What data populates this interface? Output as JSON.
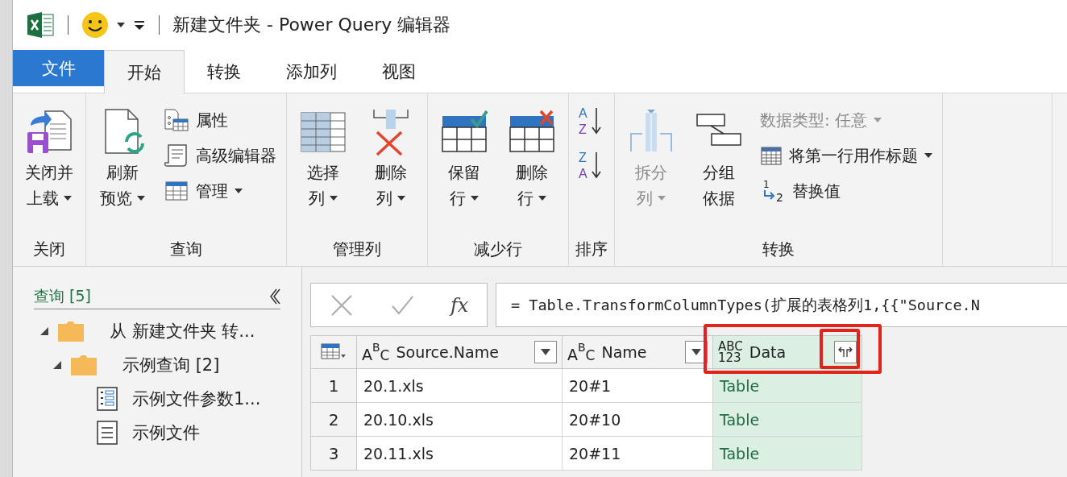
{
  "window": {
    "title": "新建文件夹 - Power Query 编辑器"
  },
  "tabs": [
    {
      "label": "文件",
      "kind": "file",
      "selected": false
    },
    {
      "label": "开始",
      "kind": "tab",
      "selected": true
    },
    {
      "label": "转换",
      "kind": "tab",
      "selected": false
    },
    {
      "label": "添加列",
      "kind": "tab",
      "selected": false
    },
    {
      "label": "视图",
      "kind": "tab",
      "selected": false
    }
  ],
  "ribbon": [
    {
      "label": "关闭",
      "items": [
        {
          "kind": "big",
          "lines": [
            "关闭并",
            "上载"
          ],
          "menu": true,
          "disabled": false
        }
      ]
    },
    {
      "label": "查询",
      "items": [
        {
          "kind": "big",
          "lines": [
            "刷新",
            "预览"
          ],
          "menu": true,
          "disabled": false
        },
        {
          "kind": "stack",
          "items": [
            {
              "label": "属性",
              "menu": false,
              "disabled": false
            },
            {
              "label": "高级编辑器",
              "menu": false,
              "disabled": false
            },
            {
              "label": "管理",
              "menu": true,
              "disabled": false
            }
          ]
        }
      ]
    },
    {
      "label": "管理列",
      "items": [
        {
          "kind": "big",
          "lines": [
            "选择",
            "列"
          ],
          "menu": true,
          "disabled": false
        },
        {
          "kind": "big",
          "lines": [
            "删除",
            "列"
          ],
          "menu": true,
          "disabled": false
        }
      ]
    },
    {
      "label": "减少行",
      "items": [
        {
          "kind": "big",
          "lines": [
            "保留",
            "行"
          ],
          "menu": true,
          "disabled": false
        },
        {
          "kind": "big",
          "lines": [
            "删除",
            "行"
          ],
          "menu": true,
          "disabled": false
        }
      ]
    },
    {
      "label": "排序",
      "items": [
        {
          "kind": "sort",
          "buttons": [
            {
              "from": "A",
              "to": "Z"
            },
            {
              "from": "Z",
              "to": "A"
            }
          ]
        }
      ]
    },
    {
      "label": "转换",
      "items": [
        {
          "kind": "big",
          "lines": [
            "拆分",
            "列"
          ],
          "menu": true,
          "disabled": true
        },
        {
          "kind": "big",
          "lines": [
            "分组",
            "依据"
          ],
          "menu": false,
          "disabled": false
        },
        {
          "kind": "stack",
          "items": [
            {
              "label": "数据类型: 任意",
              "menu": true,
              "disabled": true
            },
            {
              "label": "将第一行用作标题",
              "menu": true,
              "disabled": false
            },
            {
              "label": "替换值",
              "menu": false,
              "disabled": false,
              "glyphs": [
                "1",
                "2"
              ]
            }
          ]
        }
      ]
    }
  ],
  "queries": {
    "title": "查询 [5]",
    "tree": [
      {
        "label": "从 新建文件夹 转...",
        "kind": "folder",
        "expanded": true,
        "children": [
          {
            "label": "示例查询 [2]",
            "kind": "folder",
            "expanded": true,
            "children": [
              {
                "label": "示例文件参数1...",
                "kind": "parameter"
              },
              {
                "label": "示例文件",
                "kind": "table"
              }
            ]
          }
        ]
      }
    ]
  },
  "formula_bar": {
    "fx": "fx",
    "value": "= Table.TransformColumnTypes(扩展的表格列1,{{\"Source.N"
  },
  "table": {
    "columns": [
      {
        "label": "Source.Name",
        "kind": "text",
        "type_glyphs": [
          "A",
          "B",
          "C"
        ],
        "selected": false,
        "highlighted": false
      },
      {
        "label": "Name",
        "kind": "text",
        "type_glyphs": [
          "A",
          "B",
          "C"
        ],
        "selected": false,
        "highlighted": false
      },
      {
        "label": "Data",
        "kind": "any",
        "type_glyphs": [
          "ABC",
          "123"
        ],
        "selected": true,
        "highlighted": true
      }
    ],
    "rows": [
      {
        "number": "1",
        "cells": [
          "20.1.xls",
          "20#1",
          "Table"
        ]
      },
      {
        "number": "2",
        "cells": [
          "20.10.xls",
          "20#10",
          "Table"
        ]
      },
      {
        "number": "3",
        "cells": [
          "20.11.xls",
          "20#11",
          "Table"
        ]
      }
    ]
  }
}
